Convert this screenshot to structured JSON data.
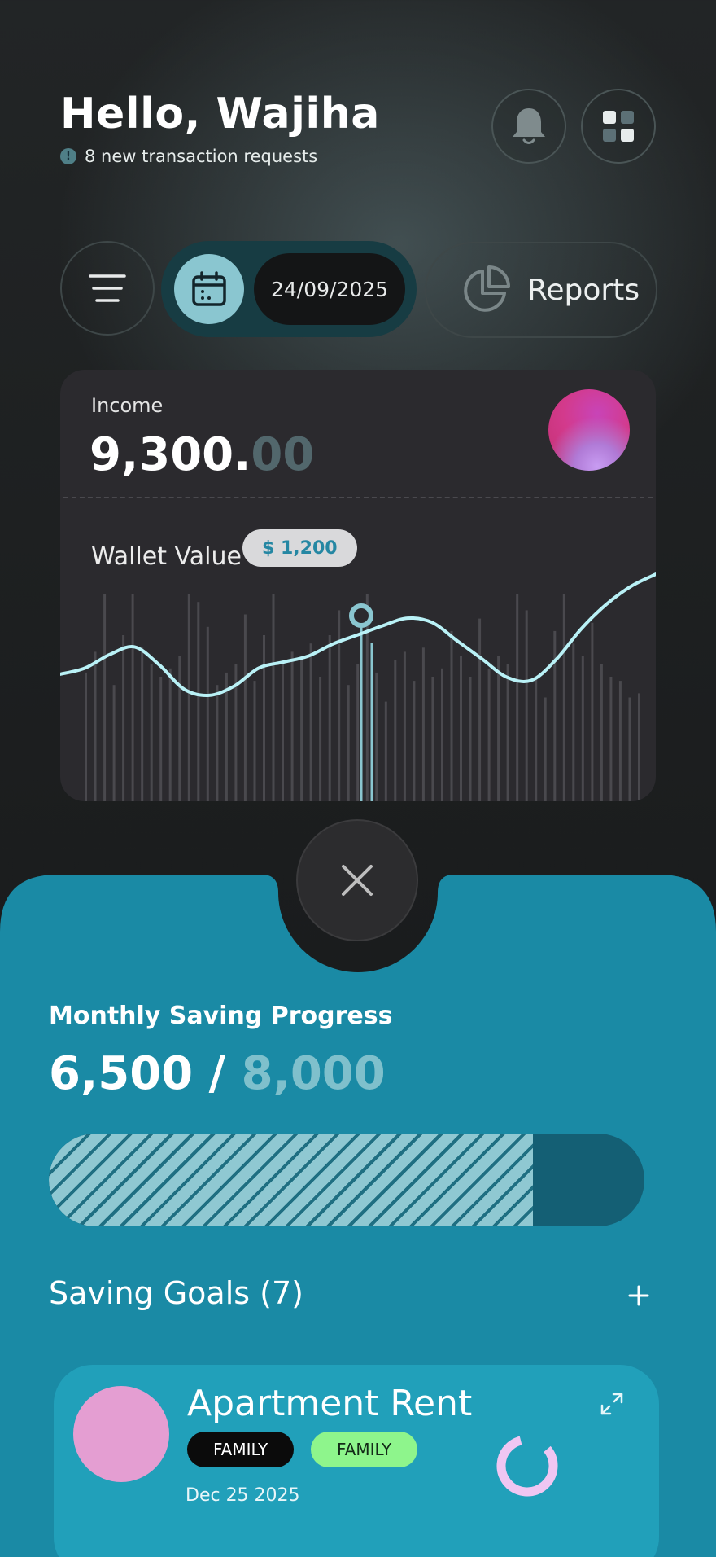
{
  "header": {
    "greeting": "Hello, Wajiha",
    "notice": "8 new transaction requests",
    "notice_icon": "info-icon",
    "notification_icon": "bell-icon",
    "apps_icon": "grid-icon"
  },
  "toolbar": {
    "menu_icon": "menu-icon",
    "calendar_icon": "calendar-icon",
    "date": "24/09/2025",
    "reports_label": "Reports",
    "reports_icon": "pie-chart-icon"
  },
  "income": {
    "label": "Income",
    "value_main": "9,300.",
    "value_decimal": "00"
  },
  "wallet": {
    "label": "Wallet Value",
    "badge": "$ 1,200"
  },
  "chart_data": {
    "type": "line",
    "y": [
      42,
      46,
      55,
      60,
      48,
      32,
      28,
      34,
      46,
      50,
      54,
      62,
      68,
      74,
      79,
      76,
      64,
      52,
      40,
      38,
      52,
      72,
      88,
      100,
      108
    ],
    "bars": [
      62,
      72,
      100,
      56,
      80,
      100,
      74,
      66,
      60,
      64,
      70,
      100,
      96,
      84,
      56,
      62,
      66,
      90,
      58,
      80,
      100,
      66,
      72,
      70,
      76,
      60,
      80,
      92,
      56,
      66,
      100,
      62,
      48,
      68,
      72,
      58,
      74,
      60,
      64,
      82,
      70,
      60,
      88,
      64,
      70,
      66,
      100,
      92,
      60,
      50,
      82,
      100,
      76,
      70,
      86,
      66,
      60,
      58,
      50,
      52
    ],
    "highlight_index": 12,
    "highlight_value": "$ 1,200",
    "colors": {
      "line": "#b9f1f6",
      "bars": "#4a494e",
      "marker": "#8ac6d0"
    }
  },
  "saving": {
    "title": "Monthly Saving Progress",
    "current": "6,500",
    "separator": " / ",
    "target": "8,000",
    "progress_fraction": 0.8125
  },
  "goals": {
    "title": "Saving Goals (7)",
    "add_label": "+",
    "items": [
      {
        "name": "Apartment Rent",
        "tags": [
          "FAMILY",
          "FAMILY"
        ],
        "date": "Dec 25 2025",
        "progress_fraction": 0.82,
        "expand_icon": "expand-icon"
      }
    ]
  },
  "close_icon": "close-icon",
  "colors": {
    "accent": "#1a8aa5",
    "card": "#2b2a2e",
    "pill": "#8ac6d0",
    "tag_green": "#8ef58c",
    "goal_avatar": "#e49ed2"
  }
}
